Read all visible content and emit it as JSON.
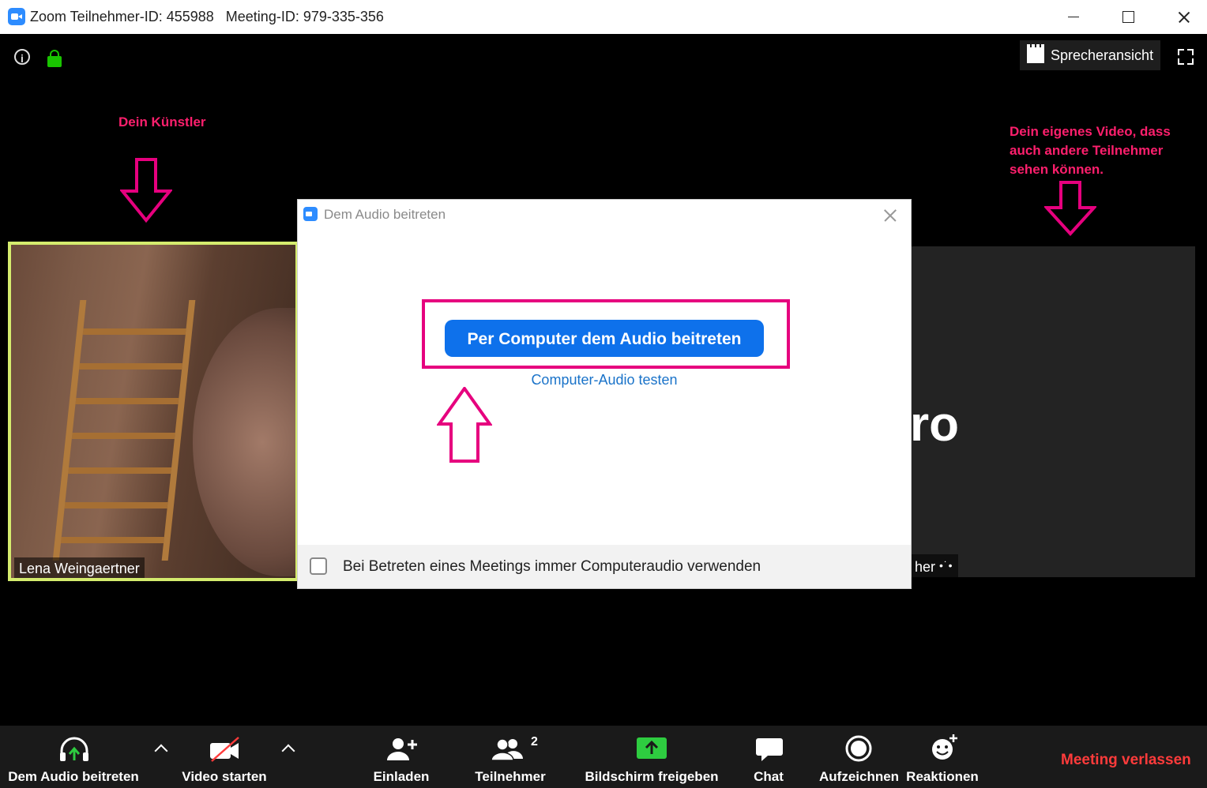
{
  "window": {
    "title": "Zoom Teilnehmer-ID: 455988   Meeting-ID: 979-335-356"
  },
  "top_controls": {
    "speaker_view_label": "Sprecheransicht"
  },
  "annotations": {
    "artist": "Dein Künstler",
    "own_video_1": "Dein eigenes Video, dass",
    "own_video_2": "auch andere Teilnehmer",
    "own_video_3": "sehen können."
  },
  "videos": {
    "left_name": "Lena Weingaertner",
    "right_name_partial": "her",
    "right_big_text": "ro"
  },
  "dialog": {
    "title": "Dem Audio beitreten",
    "join_button": "Per Computer dem Audio beitreten",
    "test_link": "Computer-Audio testen",
    "checkbox_label": "Bei Betreten eines Meetings immer Computeraudio verwenden",
    "checkbox_checked": false
  },
  "toolbar": {
    "audio": "Dem Audio beitreten",
    "video": "Video starten",
    "invite": "Einladen",
    "participants": "Teilnehmer",
    "participants_count": "2",
    "share": "Bildschirm freigeben",
    "chat": "Chat",
    "record": "Aufzeichnen",
    "reactions": "Reaktionen",
    "leave": "Meeting verlassen"
  },
  "colors": {
    "accent_blue": "#0e71eb",
    "annotation_pink": "#ff1f6d",
    "leave_red": "#ff3b3b",
    "lock_green": "#19c400"
  }
}
